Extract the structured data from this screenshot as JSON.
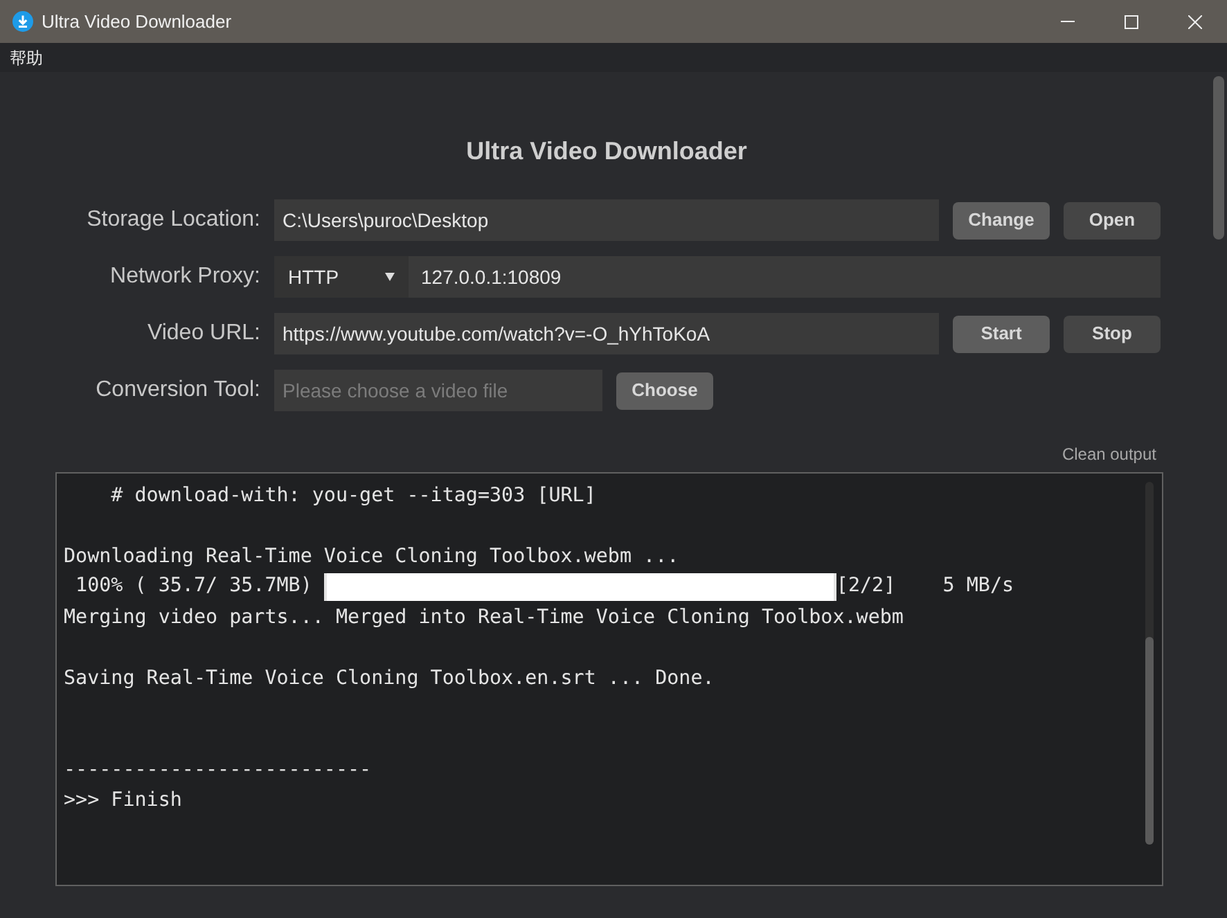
{
  "window": {
    "title": "Ultra Video Downloader"
  },
  "menu": [
    "帮助"
  ],
  "heading": "Ultra Video Downloader",
  "form": [
    {
      "kind": "path",
      "label": "Storage Location:",
      "value": "C:\\Users\\puroc\\Desktop",
      "buttons": [
        {
          "label": "Change",
          "kind": "primary"
        },
        {
          "label": "Open",
          "kind": "secondary"
        }
      ]
    },
    {
      "kind": "proxy",
      "label": "Network Proxy:",
      "protocol": "HTTP",
      "value": "127.0.0.1:10809"
    },
    {
      "kind": "path",
      "label": "Video URL:",
      "value": "https://www.youtube.com/watch?v=-O_hYhToKoA",
      "buttons": [
        {
          "label": "Start",
          "kind": "primary"
        },
        {
          "label": "Stop",
          "kind": "secondary"
        }
      ]
    },
    {
      "kind": "file",
      "label": "Conversion Tool:",
      "placeholder": "Please choose a video file",
      "buttons": [
        {
          "label": "Choose",
          "kind": "primary"
        }
      ]
    }
  ],
  "clean_output": "Clean output",
  "console": [
    {
      "kind": "text",
      "text": "    # download-with: you-get --itag=303 [URL]"
    },
    {
      "kind": "blank"
    },
    {
      "kind": "text",
      "text": "Downloading Real-Time Voice Cloning Toolbox.webm ..."
    },
    {
      "kind": "progress",
      "prefix": " 100% ( 35.7/ 35.7MB)",
      "level": 1,
      "suffix": "[2/2]    5 MB/s"
    },
    {
      "kind": "text",
      "text": "Merging video parts... Merged into Real-Time Voice Cloning Toolbox.webm"
    },
    {
      "kind": "blank"
    },
    {
      "kind": "text",
      "text": "Saving Real-Time Voice Cloning Toolbox.en.srt ... Done."
    },
    {
      "kind": "blank"
    },
    {
      "kind": "blank"
    },
    {
      "kind": "text",
      "text": "--------------------------"
    },
    {
      "kind": "text",
      "text": ">>> Finish"
    }
  ]
}
